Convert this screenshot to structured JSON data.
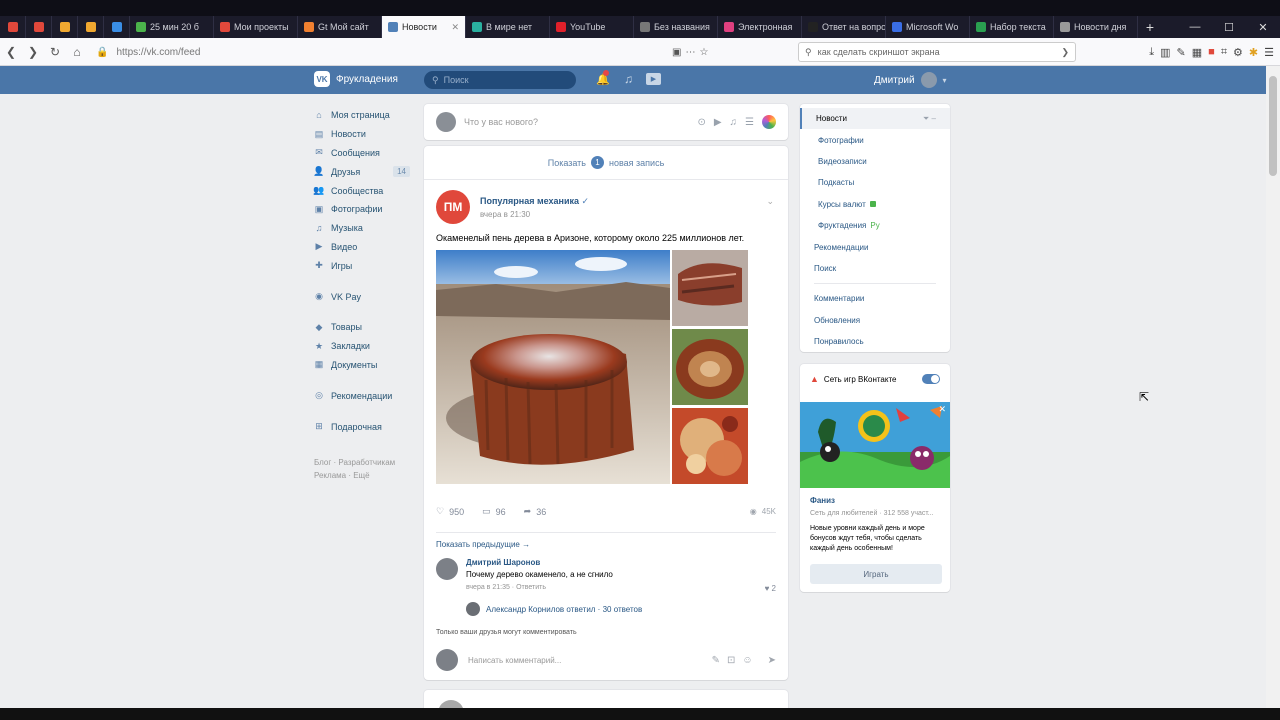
{
  "browser": {
    "tabs": [
      {
        "label": "",
        "color": "#e0483b",
        "pinned": true
      },
      {
        "label": "",
        "color": "#e0483b",
        "pinned": true
      },
      {
        "label": "",
        "color": "#f0a830",
        "pinned": true
      },
      {
        "label": "",
        "color": "#f0a830",
        "pinned": true
      },
      {
        "label": "",
        "color": "#3a8ee6",
        "pinned": true
      },
      {
        "label": "25 мин 20 б",
        "color": "#4bb34b"
      },
      {
        "label": "Мои проекты",
        "color": "#e0483b"
      },
      {
        "label": "Gt Мой сайт",
        "color": "#f08030"
      },
      {
        "label": "Новости",
        "color": "#5181b8",
        "active": true
      },
      {
        "label": "В мире нет",
        "color": "#2ab0a0"
      },
      {
        "label": "YouTube",
        "color": "#e0202a"
      },
      {
        "label": "Без названия",
        "color": "#777777"
      },
      {
        "label": "Электронная",
        "color": "#e04080"
      },
      {
        "label": "Ответ на вопрос",
        "color": "#222222"
      },
      {
        "label": "Microsoft Wo",
        "color": "#3a6ee6"
      },
      {
        "label": "Набор текста",
        "color": "#2aa050"
      },
      {
        "label": "Новости дня",
        "color": "#999999"
      }
    ],
    "url": "https://vk.com/feed",
    "search_placeholder": "как сделать скриншот экрана",
    "window_controls": [
      "—",
      "☐",
      "✕"
    ]
  },
  "vk": {
    "logo_text": "Фрукладения",
    "search_placeholder": "Поиск",
    "user_name": "Дмитрий"
  },
  "left_menu": [
    {
      "label": "Моя страница",
      "icon": "home-icon",
      "glyph": "⌂"
    },
    {
      "label": "Новости",
      "icon": "news-icon",
      "glyph": "▤"
    },
    {
      "label": "Сообщения",
      "icon": "messages-icon",
      "glyph": "✉"
    },
    {
      "label": "Друзья",
      "icon": "friends-icon",
      "glyph": "👤",
      "count": "14"
    },
    {
      "label": "Сообщества",
      "icon": "groups-icon",
      "glyph": "👥"
    },
    {
      "label": "Фотографии",
      "icon": "photos-icon",
      "glyph": "▣"
    },
    {
      "label": "Музыка",
      "icon": "music-icon",
      "glyph": "♫"
    },
    {
      "label": "Видео",
      "icon": "video-icon",
      "glyph": "▶"
    },
    {
      "label": "Игры",
      "icon": "games-icon",
      "glyph": "✚"
    },
    {
      "gap": true
    },
    {
      "label": "VK Pay",
      "icon": "vkpay-icon",
      "glyph": "◉"
    },
    {
      "gap": true
    },
    {
      "label": "Товары",
      "icon": "goods-icon",
      "glyph": "◆"
    },
    {
      "label": "Закладки",
      "icon": "bookmarks-icon",
      "glyph": "★"
    },
    {
      "label": "Документы",
      "icon": "documents-icon",
      "glyph": "▦"
    },
    {
      "gap": true
    },
    {
      "label": "Рекомендации",
      "icon": "recommend-icon",
      "glyph": "◎"
    },
    {
      "gap": true
    },
    {
      "label": "Подарочная",
      "icon": "gift-icon",
      "glyph": "⊞"
    }
  ],
  "left_footer": {
    "line1": "Блог · Разработчикам",
    "line2": "Реклама · Ещё"
  },
  "composer": {
    "placeholder": "Что у вас нового?"
  },
  "feed": {
    "show_new_label": "Показать",
    "show_new_count": "1",
    "show_new_suffix": "новая запись",
    "post": {
      "logo_text": "ПМ",
      "author": "Популярная механика",
      "verified": "✓",
      "date": "вчера в 21:30",
      "text": "Окаменелый пень дерева в Аризоне, которому около 225 миллионов лет.",
      "likes": "950",
      "comments": "96",
      "shares": "36",
      "views": "45K"
    },
    "show_more_comments": "Показать предыдущие →",
    "comment": {
      "author": "Дмитрий Шаронов",
      "text": "Почему дерево окаменело, а не сгнило",
      "meta": "вчера в 21:35 · Ответить",
      "likes": "2"
    },
    "reply_text": "Александр Корнилов ответил · 30 ответов",
    "only_friends": "Только ваши друзья могут комментировать",
    "comment_placeholder": "Написать комментарий..."
  },
  "right_filter": {
    "items": [
      {
        "label": "Новости",
        "active": true
      },
      {
        "label": "Фотографии",
        "sub": true
      },
      {
        "label": "Видеозаписи",
        "sub": true
      },
      {
        "label": "Подкасты",
        "sub": true
      },
      {
        "label": "Курсы валют",
        "sub": true,
        "badge": true
      },
      {
        "label": "Фруктадения",
        "sub": true,
        "tail": "Ру"
      },
      {
        "label": "Рекомендации"
      },
      {
        "label": "Поиск"
      },
      {
        "sep": true
      },
      {
        "label": "Комментарии"
      },
      {
        "label": "Обновления"
      },
      {
        "label": "Понравилось"
      }
    ]
  },
  "ad": {
    "header": "Сеть игр ВКонтакте",
    "title": "Фаниз",
    "subtitle": "Сеть для любителей · 312 558 участ...",
    "description": "Новые уровни каждый день и море бонусов ждут тебя, чтобы сделать каждый день особенным!",
    "button": "Играть"
  }
}
